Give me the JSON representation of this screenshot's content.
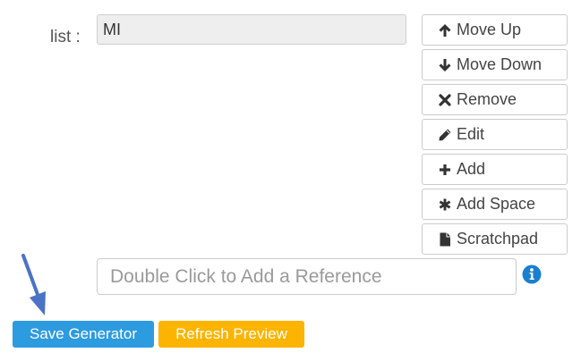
{
  "form": {
    "list_label": "list :",
    "list_items": [
      "MI"
    ]
  },
  "side_buttons": [
    {
      "label": "Move Up",
      "icon": "arrow-up-icon"
    },
    {
      "label": "Move Down",
      "icon": "arrow-down-icon"
    },
    {
      "label": "Remove",
      "icon": "remove-icon"
    },
    {
      "label": "Edit",
      "icon": "pencil-icon"
    },
    {
      "label": "Add",
      "icon": "plus-icon"
    },
    {
      "label": "Add Space",
      "icon": "asterisk-icon"
    },
    {
      "label": "Scratchpad",
      "icon": "file-icon"
    }
  ],
  "reference": {
    "placeholder": "Double Click to Add a Reference",
    "info_icon": "info-icon"
  },
  "actions": {
    "save_label": "Save Generator",
    "refresh_label": "Refresh Preview"
  },
  "colors": {
    "save": "#2d9be0",
    "refresh": "#fdb400",
    "info": "#1a7fd0",
    "arrow": "#4a73c6"
  }
}
